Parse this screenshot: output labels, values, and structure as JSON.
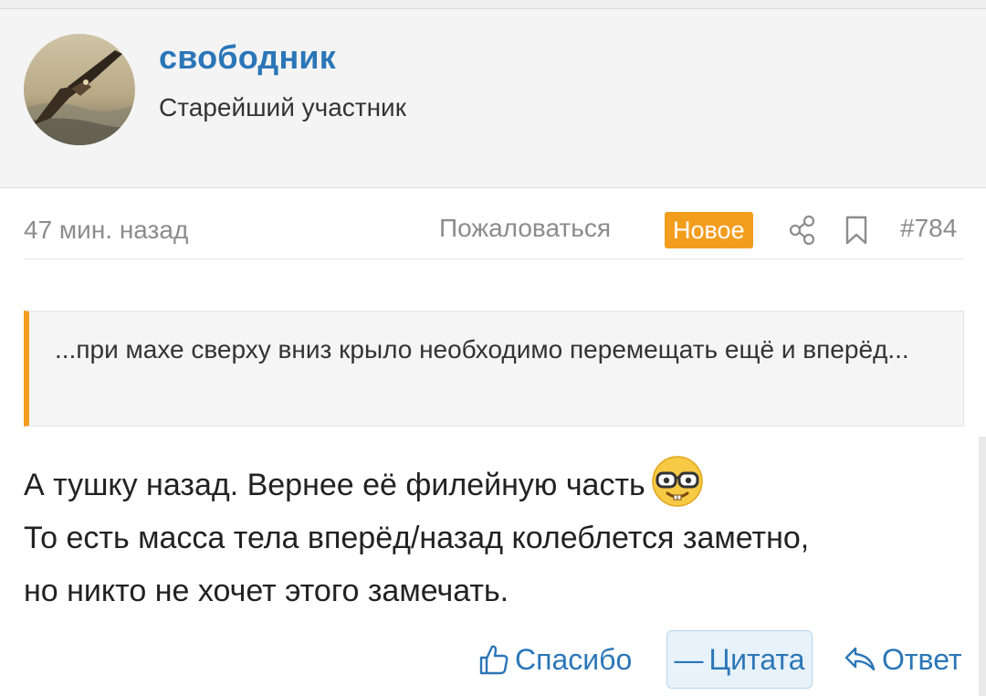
{
  "author": {
    "username": "свободник",
    "title": "Старейший участник"
  },
  "meta": {
    "time": "47 мин. назад",
    "report_label": "Пожаловаться",
    "badge_new": "Новое",
    "post_number": "#784",
    "share_icon": "share-icon",
    "bookmark_icon": "bookmark-icon"
  },
  "quote": {
    "text": "...при махе сверху вниз крыло необходимо перемещать ещё и вперёд..."
  },
  "body": {
    "lines": [
      "А тушку назад. Вернее её филейную часть",
      "То есть масса тела вперёд/назад колеблется заметно,",
      "но никто не хочет этого замечать."
    ],
    "emoji": "nerd-face-icon"
  },
  "actions": {
    "like_label": "Спасибо",
    "quote_label": "Цитата",
    "quote_prefix": "—",
    "reply_label": "Ответ"
  },
  "colors": {
    "accent": "#2b76b8",
    "new_badge": "#f39d1e",
    "quote_border": "#f39d1e",
    "muted": "#8c8c8c"
  }
}
